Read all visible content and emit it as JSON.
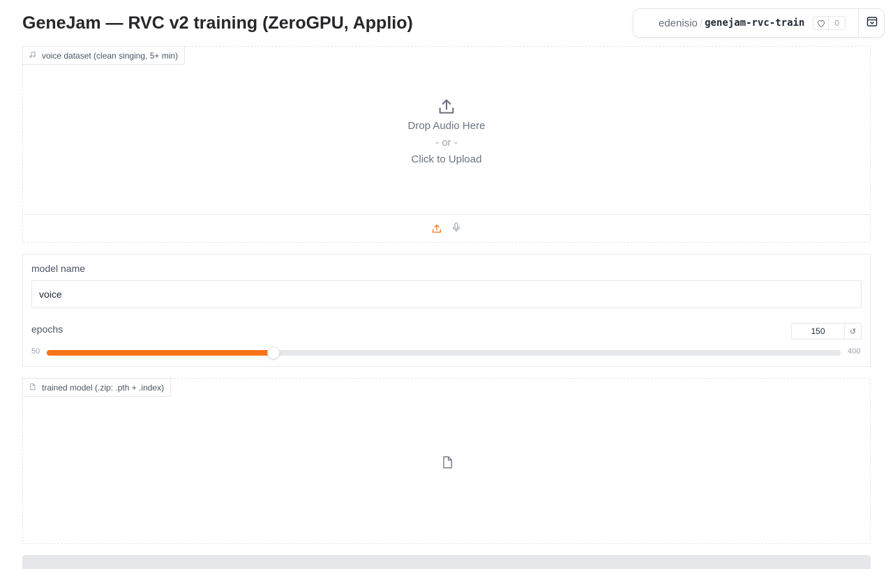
{
  "page": {
    "title": "GeneJam — RVC v2 training (ZeroGPU, Applio)"
  },
  "space_badge": {
    "owner": "edenisio",
    "separator": "/",
    "repo": "genejam-rvc-train",
    "likes": "0",
    "icons": [
      "heart-icon",
      "collapse-icon"
    ]
  },
  "audio_input": {
    "label": "voice dataset (clean singing, 5+ min)",
    "drop_text": "Drop Audio Here",
    "or_text": "- or -",
    "click_text": "Click to Upload",
    "icons": [
      "music-note-icon",
      "upload-icon",
      "microphone-icon"
    ],
    "active_source": "upload"
  },
  "model_name": {
    "label": "model name",
    "value": "voice"
  },
  "epochs": {
    "label": "epochs",
    "value": "150",
    "min": "50",
    "max": "400",
    "fraction": 0.2857,
    "reset_symbol": "↺"
  },
  "output_file": {
    "label": "trained model (.zip: .pth + .index)",
    "icons": [
      "file-icon"
    ]
  },
  "colors": {
    "accent": "#f97316",
    "border": "#e5e7eb",
    "muted_text": "#6b7280"
  }
}
